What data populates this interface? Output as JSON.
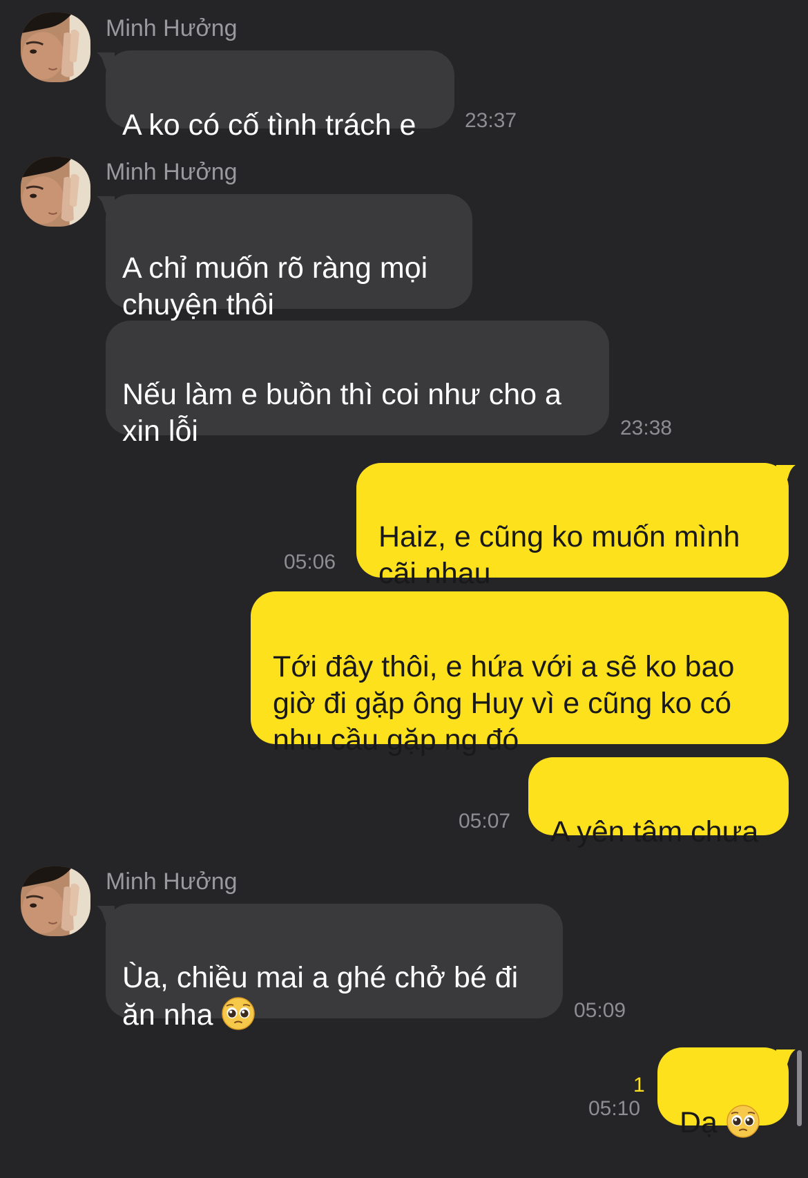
{
  "chat": {
    "messages": [
      {
        "sender": "Minh Hưởng",
        "text": "A ko có cố tình trách e",
        "time": "23:37"
      },
      {
        "sender": "Minh Hưởng",
        "text": "A chỉ muốn rõ ràng mọi\nchuyện thôi"
      },
      {
        "text": "Nếu làm e buồn thì coi như cho a\nxin lỗi",
        "time": "23:38"
      },
      {
        "text": "Haiz, e cũng ko muốn mình\ncãi nhau",
        "time": "05:06"
      },
      {
        "text": "Tới đây thôi, e hứa với a sẽ ko bao\ngiờ đi gặp ông Huy vì e cũng ko có\nnhu cầu gặp ng đó"
      },
      {
        "text": "A yên tâm chưa",
        "time": "05:07"
      },
      {
        "sender": "Minh Hưởng",
        "text": "Ùa, chiều mai a ghé chở bé đi\năn nha",
        "time": "05:09"
      },
      {
        "text": "Dạ",
        "time": "05:10",
        "unread": "1"
      }
    ]
  },
  "icons": {
    "emoji": "pleading-face-icon",
    "avatar": "profile-photo"
  },
  "colors": {
    "background": "#252527",
    "incoming_bubble": "#3a3a3c",
    "outgoing_bubble": "#fde11d",
    "timestamp": "#8e8e92",
    "sender_name": "#9a9a9e"
  }
}
